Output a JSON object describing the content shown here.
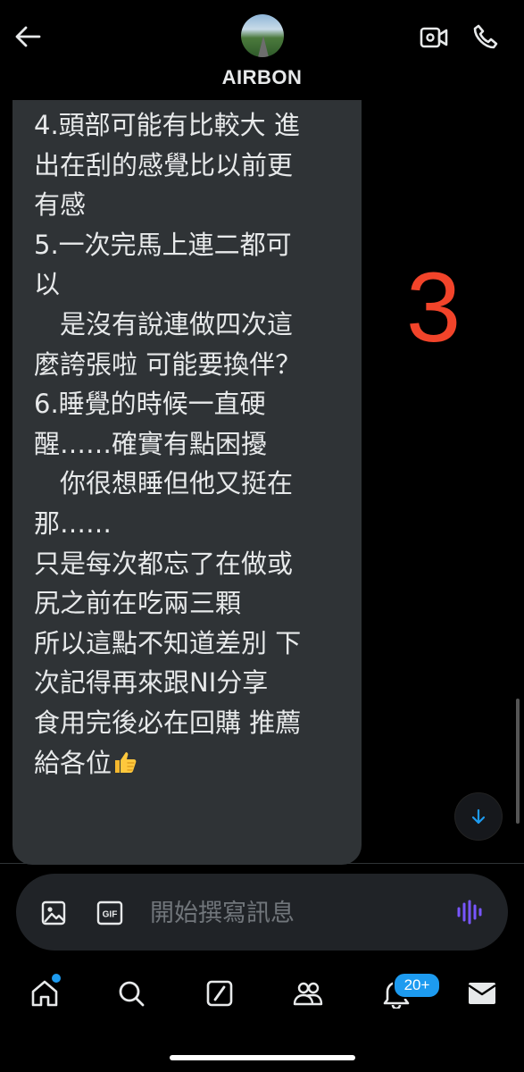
{
  "header": {
    "contact_name": "AIRBON",
    "icons": {
      "back": "back-arrow-icon",
      "video": "video-call-icon",
      "call": "phone-icon"
    }
  },
  "message": {
    "lines": [
      "4.頭部可能有比較大 進",
      "出在刮的感覺比以前更",
      "有感",
      "5.一次完馬上連二都可",
      "以",
      "　是沒有說連做四次這",
      "麼誇張啦 可能要換伴？",
      "6.睡覺的時候一直硬",
      "醒……確實有點困擾",
      "　你很想睡但他又挺在",
      "那……",
      "",
      "只是每次都忘了在做或",
      "尻之前在吃兩三顆",
      "所以這點不知道差別 下",
      "次記得再來跟NI分享",
      "",
      "食用完後必在回購 推薦",
      "給各位"
    ],
    "emoji": "thumbs-up-emoji"
  },
  "annotation": {
    "text": "3",
    "color": "#f2442a"
  },
  "composer": {
    "placeholder": "開始撰寫訊息",
    "icons": {
      "image": "image-icon",
      "gif": "gif-icon",
      "voice": "voice-waveform-icon"
    }
  },
  "tabbar": {
    "notification_badge": "20+",
    "icons": [
      "home-icon",
      "search-icon",
      "grok-icon",
      "communities-icon",
      "notifications-icon",
      "messages-icon"
    ]
  },
  "colors": {
    "background": "#000000",
    "bubble": "#2f3336",
    "accent": "#1d9bf0",
    "voice": "#7856ff"
  }
}
